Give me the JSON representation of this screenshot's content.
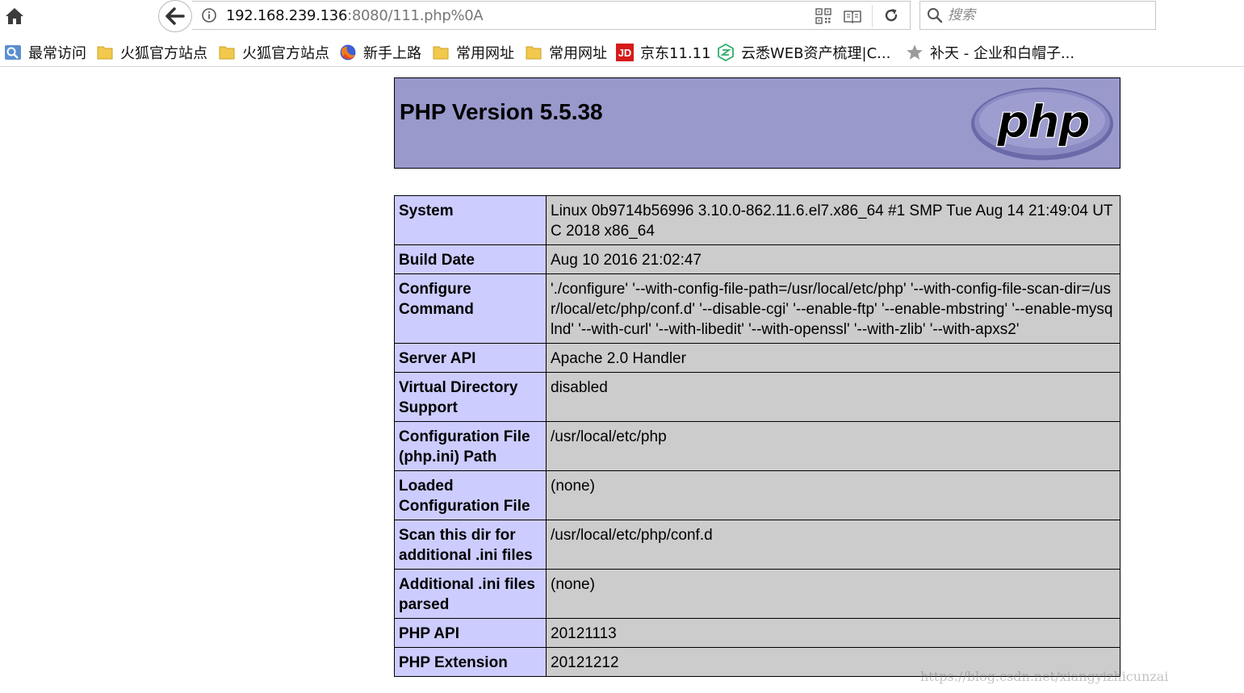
{
  "browser": {
    "url_host": "192.168.239.136",
    "url_rest": ":8080/111.php%0A",
    "search_placeholder": "搜索",
    "bookmarks": [
      {
        "label": "最常访问",
        "icon": "most-visited-icon"
      },
      {
        "label": "火狐官方站点",
        "icon": "folder-icon"
      },
      {
        "label": "火狐官方站点",
        "icon": "folder-icon"
      },
      {
        "label": "新手上路",
        "icon": "firefox-icon"
      },
      {
        "label": "常用网址",
        "icon": "folder-icon"
      },
      {
        "label": "常用网址",
        "icon": "folder-icon"
      },
      {
        "label": "京东11.11",
        "icon": "jd-icon"
      },
      {
        "label": "云悉WEB资产梳理|C...",
        "icon": "yunxi-icon"
      },
      {
        "label": "补天 - 企业和白帽子...",
        "icon": "butian-star-icon"
      }
    ],
    "logo_text": "JD"
  },
  "page": {
    "title": "PHP Version 5.5.38",
    "logo_text": "php",
    "rows": [
      {
        "key": "System",
        "value": "Linux 0b9714b56996 3.10.0-862.11.6.el7.x86_64 #1 SMP Tue Aug 14 21:49:04 UTC 2018 x86_64"
      },
      {
        "key": "Build Date",
        "value": "Aug 10 2016 21:02:47"
      },
      {
        "key": "Configure Command",
        "value": "'./configure' '--with-config-file-path=/usr/local/etc/php' '--with-config-file-scan-dir=/usr/local/etc/php/conf.d' '--disable-cgi' '--enable-ftp' '--enable-mbstring' '--enable-mysqlnd' '--with-curl' '--with-libedit' '--with-openssl' '--with-zlib' '--with-apxs2'"
      },
      {
        "key": "Server API",
        "value": "Apache 2.0 Handler"
      },
      {
        "key": "Virtual Directory Support",
        "value": "disabled"
      },
      {
        "key": "Configuration File (php.ini) Path",
        "value": "/usr/local/etc/php"
      },
      {
        "key": "Loaded Configuration File",
        "value": "(none)"
      },
      {
        "key": "Scan this dir for additional .ini files",
        "value": "/usr/local/etc/php/conf.d"
      },
      {
        "key": "Additional .ini files parsed",
        "value": "(none)"
      },
      {
        "key": "PHP API",
        "value": "20121113"
      },
      {
        "key": "PHP Extension",
        "value": "20121212"
      }
    ]
  },
  "watermark": "https://blog.csdn.net/xiangyizhicunzai",
  "colors": {
    "header_bg": "#9999cc",
    "key_bg": "#ccccff",
    "value_bg": "#cccccc"
  }
}
